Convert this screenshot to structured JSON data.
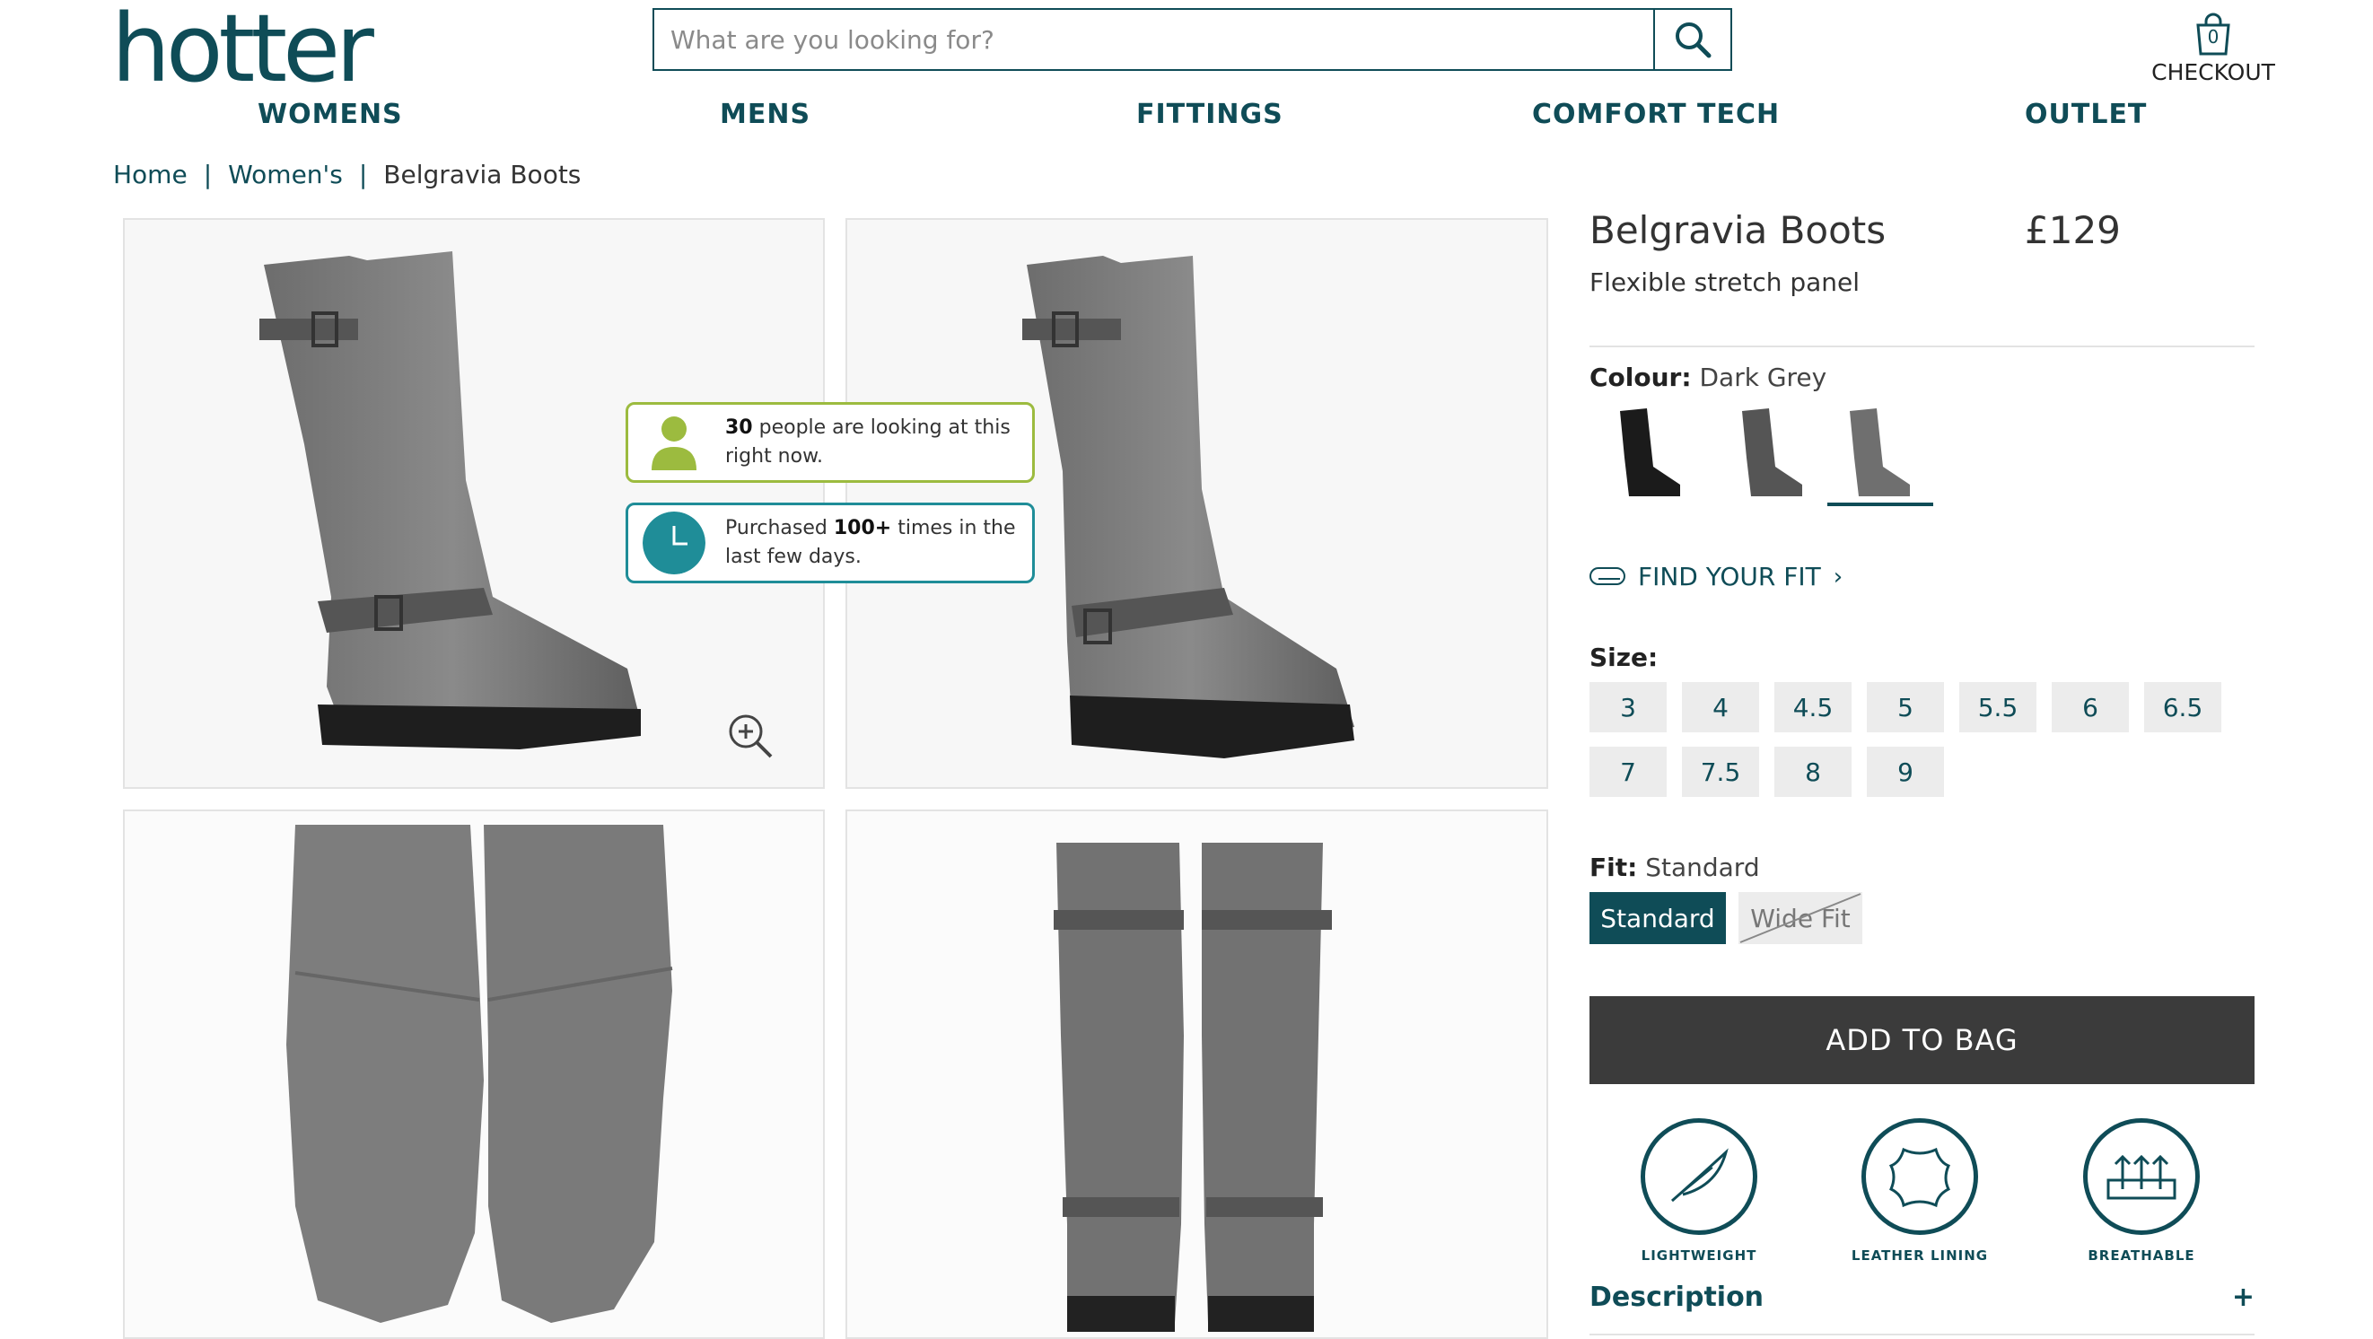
{
  "brand": {
    "logo": "hotter",
    "reg": "®"
  },
  "search": {
    "placeholder": "What are you looking for?"
  },
  "checkout": {
    "label": "CHECKOUT",
    "count": "0"
  },
  "nav": [
    "WOMENS",
    "MENS",
    "FITTINGS",
    "COMFORT TECH",
    "OUTLET"
  ],
  "breadcrumb": {
    "home": "Home",
    "womens": "Women's",
    "current": "Belgravia Boots",
    "sep": "|"
  },
  "badges": {
    "viewers_count": "30",
    "viewers_text": " people are looking at this right now.",
    "purchased_prefix": "Purchased ",
    "purchased_count": "100+",
    "purchased_suffix": " times in the last few days."
  },
  "product": {
    "name": "Belgravia Boots",
    "price": "£129",
    "subtitle": "Flexible stretch panel",
    "colour_label": "Colour:",
    "colour_value": "Dark Grey",
    "find_fit": "FIND YOUR FIT",
    "size_label": "Size:",
    "sizes": [
      "3",
      "4",
      "4.5",
      "5",
      "5.5",
      "6",
      "6.5",
      "7",
      "7.5",
      "8",
      "9"
    ],
    "fit_label": "Fit:",
    "fit_value": "Standard",
    "fit_options": [
      "Standard",
      "Wide Fit"
    ],
    "add_to_bag": "ADD TO BAG",
    "features": [
      "LIGHTWEIGHT",
      "LEATHER LINING",
      "BREATHABLE"
    ],
    "description": "Description",
    "description_toggle": "+"
  },
  "colors": {
    "brand": "#0f4c57",
    "viewers_badge": "#9cbb3f",
    "purchase_badge": "#1f8d98",
    "button_dark": "#3b3b3b"
  }
}
